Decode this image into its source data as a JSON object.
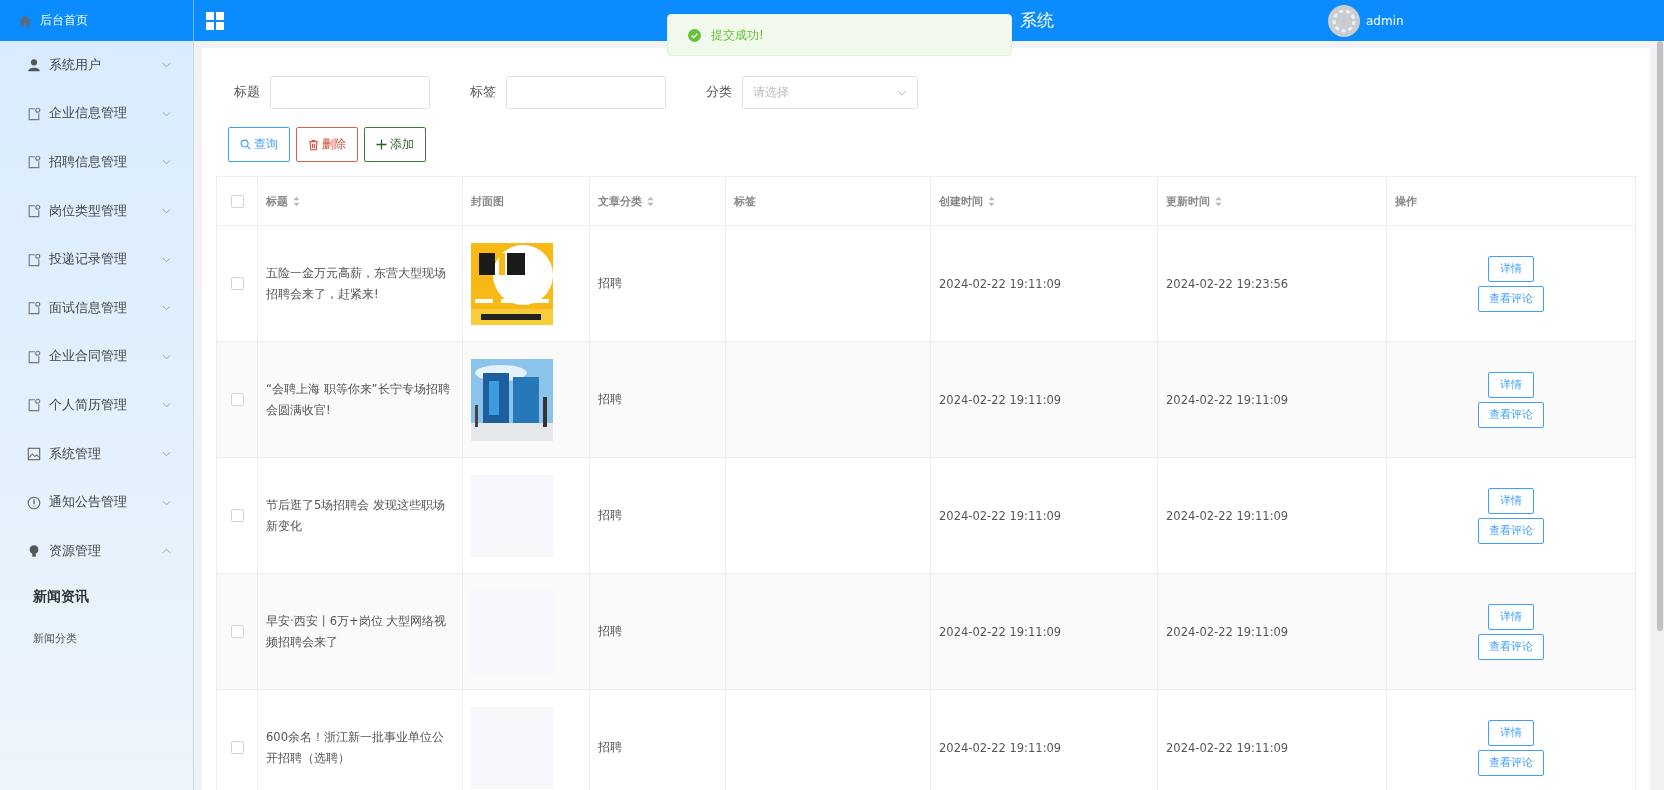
{
  "header": {
    "home": "后台首页",
    "title": "系统",
    "user": "admin"
  },
  "toast": {
    "message": "提交成功!"
  },
  "sidebar": {
    "items": [
      {
        "label": "系统用户",
        "expanded": false
      },
      {
        "label": "企业信息管理",
        "expanded": false
      },
      {
        "label": "招聘信息管理",
        "expanded": false
      },
      {
        "label": "岗位类型管理",
        "expanded": false
      },
      {
        "label": "投递记录管理",
        "expanded": false
      },
      {
        "label": "面试信息管理",
        "expanded": false
      },
      {
        "label": "企业合同管理",
        "expanded": false
      },
      {
        "label": "个人简历管理",
        "expanded": false
      },
      {
        "label": "系统管理",
        "expanded": false
      },
      {
        "label": "通知公告管理",
        "expanded": false
      },
      {
        "label": "资源管理",
        "expanded": true,
        "children": [
          {
            "label": "新闻资讯",
            "selected": true
          },
          {
            "label": "新闻分类",
            "selected": false
          }
        ]
      }
    ]
  },
  "filters": [
    {
      "label": "标题",
      "kind": "text"
    },
    {
      "label": "标签",
      "kind": "text"
    },
    {
      "label": "分类",
      "kind": "select",
      "placeholder": "请选择"
    }
  ],
  "buttons": [
    {
      "label": "查询",
      "kind": "search"
    },
    {
      "label": "删除",
      "kind": "delete"
    },
    {
      "label": "添加",
      "kind": "add"
    }
  ],
  "table": {
    "all_checked": false,
    "columns": [
      {
        "label": "标题",
        "sortable": true
      },
      {
        "label": "封面图",
        "sortable": false
      },
      {
        "label": "文章分类",
        "sortable": true
      },
      {
        "label": "标签",
        "sortable": false
      },
      {
        "label": "创建时间",
        "sortable": true
      },
      {
        "label": "更新时间",
        "sortable": true
      },
      {
        "label": "操作",
        "sortable": false
      }
    ],
    "rows": [
      {
        "checked": false,
        "title": "五险一金万元高薪，东营大型现场招聘会来了，赶紧来!",
        "cover": {
          "kind": "picture"
        },
        "category": "招聘",
        "created": "2024-02-22 19:11:09",
        "updated": "2024-02-22 19:23:56",
        "actions": [
          "详情",
          "查看评论"
        ]
      },
      {
        "checked": false,
        "title": "“会聘上海 职等你来”长宁专场招聘会圆满收官!",
        "cover": {
          "kind": "picture"
        },
        "category": "招聘",
        "created": "2024-02-22 19:11:09",
        "updated": "2024-02-22 19:11:09",
        "actions": [
          "详情",
          "查看评论"
        ]
      },
      {
        "checked": false,
        "title": "节后逛了5场招聘会 发现这些职场新变化",
        "category": "招聘",
        "created": "2024-02-22 19:11:09",
        "updated": "2024-02-22 19:11:09",
        "actions": [
          "详情",
          "查看评论"
        ]
      },
      {
        "checked": false,
        "title": "早安·西安丨6万+岗位 大型网络视频招聘会来了",
        "category": "招聘",
        "created": "2024-02-22 19:11:09",
        "updated": "2024-02-22 19:11:09",
        "actions": [
          "详情",
          "查看评论"
        ]
      },
      {
        "checked": false,
        "title": "600余名！浙江新一批事业单位公开招聘（选聘）",
        "category": "招聘",
        "created": "2024-02-22 19:11:09",
        "updated": "2024-02-22 19:11:09",
        "actions": [
          "详情",
          "查看评论"
        ]
      }
    ]
  }
}
